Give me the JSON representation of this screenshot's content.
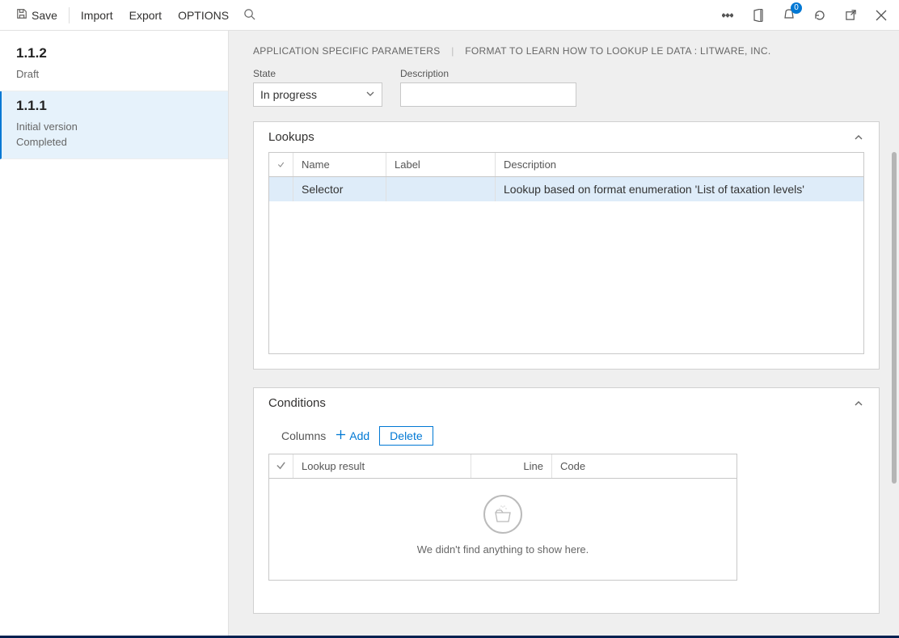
{
  "toolbar": {
    "save": "Save",
    "import": "Import",
    "export": "Export",
    "options": "OPTIONS"
  },
  "notification_count": "0",
  "sidebar": {
    "versions": [
      {
        "title": "1.1.2",
        "line1": "Draft",
        "line2": ""
      },
      {
        "title": "1.1.1",
        "line1": "Initial version",
        "line2": "Completed"
      }
    ]
  },
  "breadcrumb": {
    "part1": "APPLICATION SPECIFIC PARAMETERS",
    "part2": "FORMAT TO LEARN HOW TO LOOKUP LE DATA : LITWARE, INC."
  },
  "form": {
    "state_label": "State",
    "state_value": "In progress",
    "description_label": "Description",
    "description_value": ""
  },
  "lookups": {
    "title": "Lookups",
    "columns": {
      "name": "Name",
      "label": "Label",
      "description": "Description"
    },
    "rows": [
      {
        "name": "Selector",
        "label": "",
        "description": "Lookup based on format enumeration 'List of taxation levels'"
      }
    ]
  },
  "conditions": {
    "title": "Conditions",
    "toolbar": {
      "columns": "Columns",
      "add": "Add",
      "delete": "Delete"
    },
    "columns": {
      "lookup_result": "Lookup result",
      "line": "Line",
      "code": "Code"
    },
    "empty_message": "We didn't find anything to show here."
  }
}
